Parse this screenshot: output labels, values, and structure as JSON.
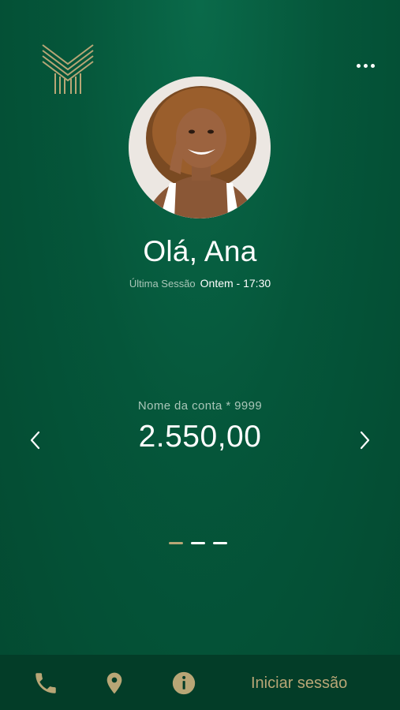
{
  "header": {
    "logo_icon": "bank-logo-icon",
    "more_icon": "more-horizontal-icon"
  },
  "profile": {
    "avatar_icon": "user-avatar",
    "greeting": "Olá, Ana",
    "last_session_label": "Última Sessão",
    "last_session_value": "Ontem - 17:30"
  },
  "account": {
    "name": "Nome da conta * 9999",
    "balance": "2.550,00",
    "prev_icon": "chevron-left-icon",
    "next_icon": "chevron-right-icon",
    "pages": 3,
    "active_page": 1
  },
  "bottom_bar": {
    "phone_icon": "phone-icon",
    "location_icon": "location-pin-icon",
    "info_icon": "info-icon",
    "login_label": "Iniciar sessão"
  },
  "colors": {
    "background": "#05563a",
    "accent_gold": "#b8a676",
    "bottom_bar": "#033d28",
    "muted_text": "#a9c6b8"
  }
}
